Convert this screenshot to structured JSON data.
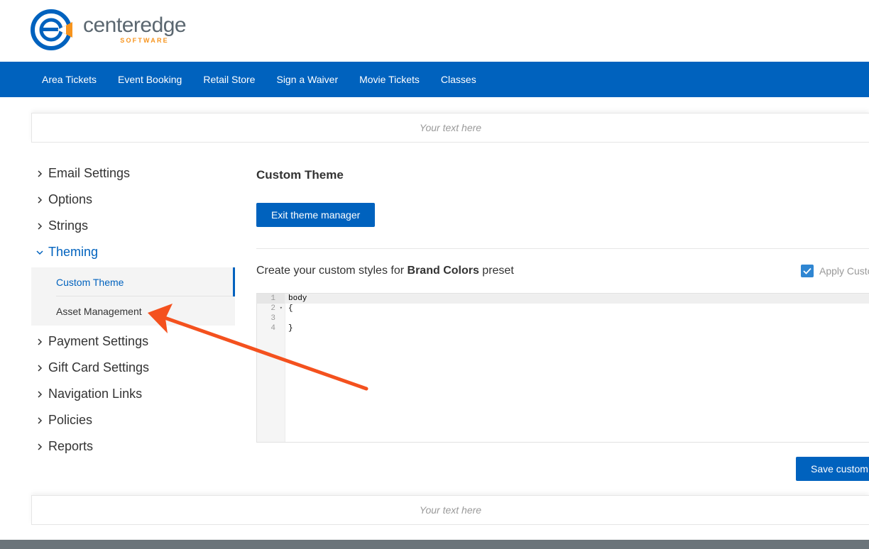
{
  "brand": {
    "name": "centeredge",
    "sub": "SOFTWARE",
    "colors": {
      "blue": "#0062be",
      "orange": "#f7941d",
      "gray": "#5b6770"
    }
  },
  "nav": {
    "items": [
      {
        "label": "Area Tickets"
      },
      {
        "label": "Event Booking"
      },
      {
        "label": "Retail Store"
      },
      {
        "label": "Sign a Waiver"
      },
      {
        "label": "Movie Tickets"
      },
      {
        "label": "Classes"
      }
    ]
  },
  "banner_top": {
    "text": "Your text here"
  },
  "banner_bottom": {
    "text": "Your text here"
  },
  "sidebar": {
    "items": [
      {
        "label": "Email Settings",
        "expanded": false
      },
      {
        "label": "Options",
        "expanded": false
      },
      {
        "label": "Strings",
        "expanded": false
      },
      {
        "label": "Theming",
        "expanded": true
      },
      {
        "label": "Payment Settings",
        "expanded": false
      },
      {
        "label": "Gift Card Settings",
        "expanded": false
      },
      {
        "label": "Navigation Links",
        "expanded": false
      },
      {
        "label": "Policies",
        "expanded": false
      },
      {
        "label": "Reports",
        "expanded": false
      }
    ],
    "theming_sub": [
      {
        "label": "Custom Theme",
        "active": true
      },
      {
        "label": "Asset Management",
        "active": false
      }
    ]
  },
  "main": {
    "title": "Custom Theme",
    "exit_button": "Exit theme manager",
    "preset_prefix": "Create your custom styles for ",
    "preset_name": "Brand Colors",
    "preset_suffix": " preset",
    "apply_label": "Apply Custo",
    "apply_checked": true,
    "save_button": "Save custom",
    "editor": {
      "line_numbers": [
        "1",
        "2",
        "3",
        "4"
      ],
      "lines": [
        "body",
        "{",
        "",
        "}"
      ]
    }
  },
  "annotation": {
    "arrow_color": "#f4511e",
    "points_to": "Asset Management"
  }
}
